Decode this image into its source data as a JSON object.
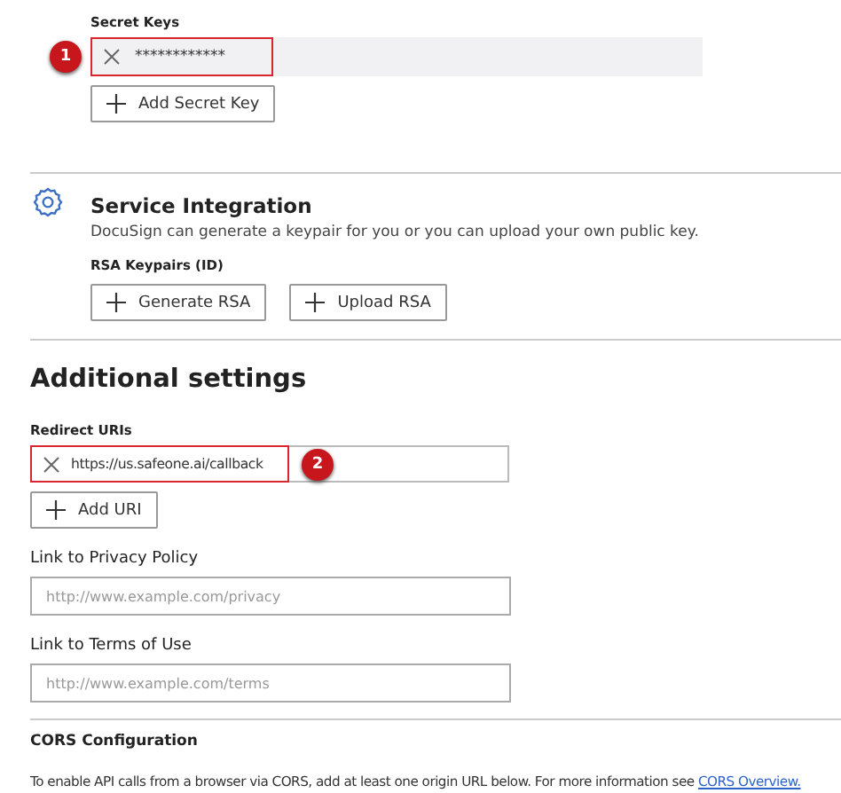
{
  "secret_keys": {
    "label": "Secret Keys",
    "keys": [
      {
        "value": "************",
        "highlighted": true,
        "badge": "1"
      }
    ],
    "add_button": "Add Secret Key"
  },
  "service_integration": {
    "title": "Service Integration",
    "description": "DocuSign can generate a keypair for you or you can upload your own public key.",
    "rsa_label": "RSA Keypairs (ID)",
    "buttons": [
      "Generate RSA",
      "Upload RSA"
    ]
  },
  "additional_settings": {
    "title": "Additional settings",
    "redirect_label": "Redirect URIs",
    "redirect_uris": [
      {
        "value": "https://us.safeone.ai/callback",
        "highlighted": true,
        "badge": "2"
      }
    ],
    "add_uri_button": "Add URI",
    "fields": [
      {
        "label": "Link to Privacy Policy",
        "placeholder": "http://www.example.com/privacy"
      },
      {
        "label": "Link to Terms of Use",
        "placeholder": "http://www.example.com/terms"
      }
    ]
  },
  "cors": {
    "title": "CORS Configuration",
    "text": "To enable API calls from a browser via CORS, add at least one origin URL below. For more information see ",
    "link": "CORS Overview."
  }
}
